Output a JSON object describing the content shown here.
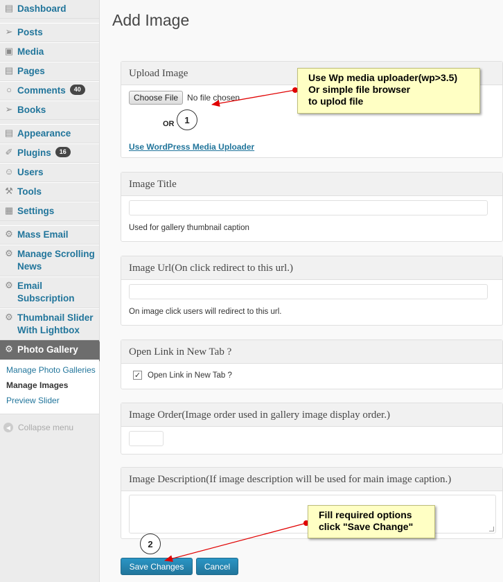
{
  "sidebar": {
    "items": [
      {
        "label": "Dashboard",
        "icon": "dashboard-icon"
      },
      {
        "label": "Posts",
        "icon": "pin-icon"
      },
      {
        "label": "Media",
        "icon": "media-icon"
      },
      {
        "label": "Pages",
        "icon": "pages-icon"
      },
      {
        "label": "Comments",
        "icon": "comment-icon",
        "badge": "40"
      },
      {
        "label": "Books",
        "icon": "pin-icon"
      },
      {
        "label": "Appearance",
        "icon": "appearance-icon"
      },
      {
        "label": "Plugins",
        "icon": "plugin-icon",
        "badge": "16"
      },
      {
        "label": "Users",
        "icon": "users-icon"
      },
      {
        "label": "Tools",
        "icon": "tools-icon"
      },
      {
        "label": "Settings",
        "icon": "settings-icon"
      },
      {
        "label": "Mass Email",
        "icon": "gear-icon"
      },
      {
        "label": "Manage Scrolling News",
        "icon": "gear-icon"
      },
      {
        "label": "Email Subscription",
        "icon": "gear-icon"
      },
      {
        "label": "Thumbnail Slider With Lightbox",
        "icon": "gear-icon"
      },
      {
        "label": "Photo Gallery",
        "icon": "gear-icon"
      }
    ],
    "submenu": [
      "Manage Photo Galleries",
      "Manage Images",
      "Preview Slider"
    ],
    "collapse": "Collapse menu"
  },
  "page": {
    "title": "Add Image"
  },
  "upload": {
    "heading": "Upload Image",
    "choose_label": "Choose File",
    "no_file": "No file chosen",
    "or": "OR",
    "media_link": "Use WordPress Media Uploader"
  },
  "image_title": {
    "heading": "Image Title",
    "value": "",
    "help": "Used for gallery thumbnail caption"
  },
  "image_url": {
    "heading": "Image Url(On click redirect to this url.)",
    "value": "",
    "help": "On image click users will redirect to this url."
  },
  "new_tab": {
    "heading": "Open Link in New Tab ?",
    "checkbox_label": "Open Link in New Tab ?",
    "checked": true
  },
  "image_order": {
    "heading": "Image Order(Image order used in gallery image display order.)",
    "value": ""
  },
  "image_description": {
    "heading": "Image Description(If image description will be used for main image caption.)",
    "value": ""
  },
  "buttons": {
    "save": "Save Changes",
    "cancel": "Cancel"
  },
  "annotations": {
    "callout1": [
      "Use Wp media uploader(wp>3.5)",
      "Or simple file browser",
      "to uplod file"
    ],
    "callout2": [
      "Fill required options",
      "click \"Save Change\""
    ],
    "step1": "1",
    "step2": "2",
    "arrow_color": "#e00000"
  }
}
